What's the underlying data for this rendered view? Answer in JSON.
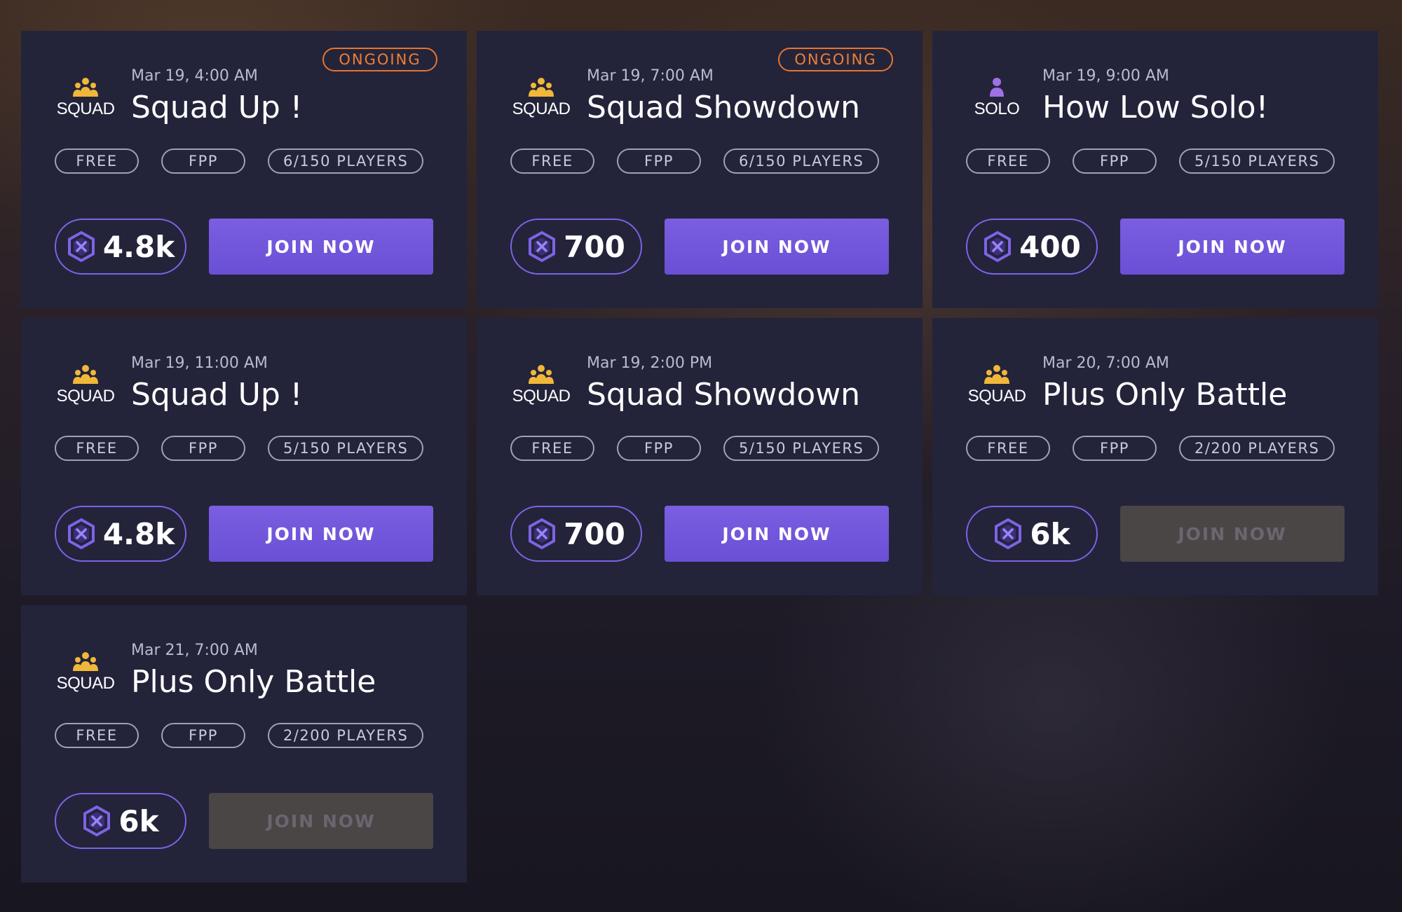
{
  "colors": {
    "accent": "#6a4fd6",
    "ongoing": "#ee7f36",
    "card_bg": "#23243a",
    "squad_icon": "#f0b73a",
    "solo_icon": "#a070e8",
    "disabled_button": "#4a4646"
  },
  "tournaments": [
    {
      "status": "ONGOING",
      "mode_icon": "squad-icon",
      "mode": "SQUAD",
      "datetime": "Mar 19, 4:00 AM",
      "title": "Squad Up !",
      "tags": [
        "FREE",
        "FPP",
        "6/150 PLAYERS"
      ],
      "prize_icon": "coin-icon",
      "prize": "4.8k",
      "button": "JOIN NOW",
      "button_enabled": true
    },
    {
      "status": "ONGOING",
      "mode_icon": "squad-icon",
      "mode": "SQUAD",
      "datetime": "Mar 19, 7:00 AM",
      "title": "Squad Showdown",
      "tags": [
        "FREE",
        "FPP",
        "6/150 PLAYERS"
      ],
      "prize_icon": "coin-icon",
      "prize": "700",
      "button": "JOIN NOW",
      "button_enabled": true
    },
    {
      "status": "",
      "mode_icon": "solo-icon",
      "mode": "SOLO",
      "datetime": "Mar 19, 9:00 AM",
      "title": "How Low Solo!",
      "tags": [
        "FREE",
        "FPP",
        "5/150 PLAYERS"
      ],
      "prize_icon": "coin-icon",
      "prize": "400",
      "button": "JOIN NOW",
      "button_enabled": true
    },
    {
      "status": "",
      "mode_icon": "squad-icon",
      "mode": "SQUAD",
      "datetime": "Mar 19, 11:00 AM",
      "title": "Squad Up !",
      "tags": [
        "FREE",
        "FPP",
        "5/150 PLAYERS"
      ],
      "prize_icon": "coin-icon",
      "prize": "4.8k",
      "button": "JOIN NOW",
      "button_enabled": true
    },
    {
      "status": "",
      "mode_icon": "squad-icon",
      "mode": "SQUAD",
      "datetime": "Mar 19, 2:00 PM",
      "title": "Squad Showdown",
      "tags": [
        "FREE",
        "FPP",
        "5/150 PLAYERS"
      ],
      "prize_icon": "coin-icon",
      "prize": "700",
      "button": "JOIN NOW",
      "button_enabled": true
    },
    {
      "status": "",
      "mode_icon": "squad-icon",
      "mode": "SQUAD",
      "datetime": "Mar 20, 7:00 AM",
      "title": "Plus Only Battle",
      "tags": [
        "FREE",
        "FPP",
        "2/200 PLAYERS"
      ],
      "prize_icon": "coin-icon",
      "prize": "6k",
      "button": "JOIN NOW",
      "button_enabled": false
    },
    {
      "status": "",
      "mode_icon": "squad-icon",
      "mode": "SQUAD",
      "datetime": "Mar 21, 7:00 AM",
      "title": "Plus Only Battle",
      "tags": [
        "FREE",
        "FPP",
        "2/200 PLAYERS"
      ],
      "prize_icon": "coin-icon",
      "prize": "6k",
      "button": "JOIN NOW",
      "button_enabled": false
    }
  ]
}
